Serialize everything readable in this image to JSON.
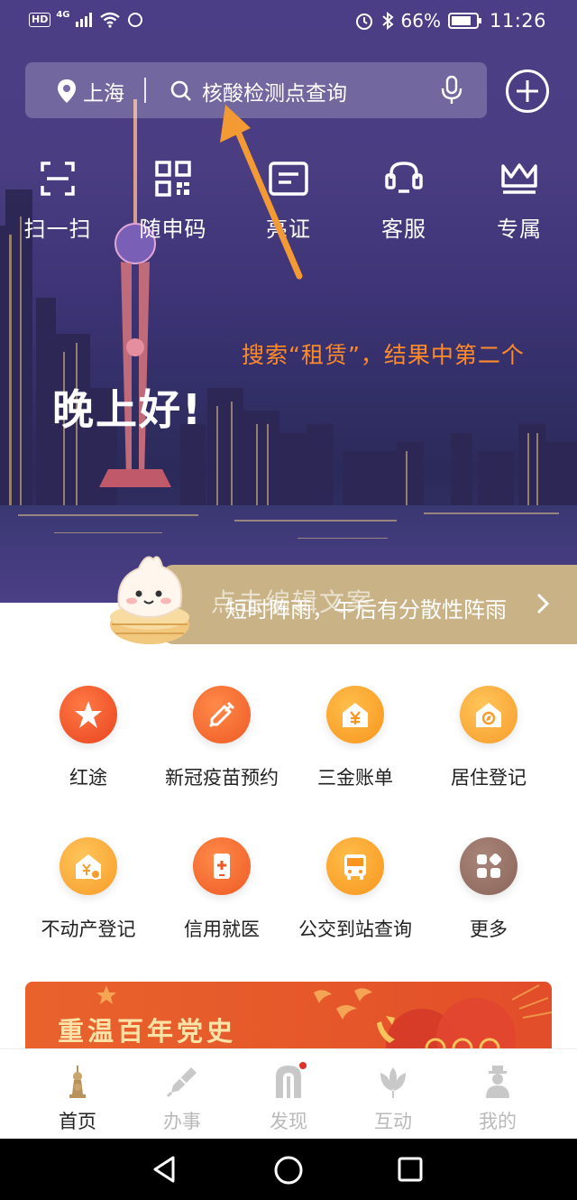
{
  "status_bar": {
    "hd": "HD",
    "network": "4G",
    "battery": "66%",
    "time": "11:26"
  },
  "search": {
    "city": "上海",
    "query": "核酸检测点查询"
  },
  "quick_actions": [
    {
      "label": "扫一扫",
      "icon": "scan-icon"
    },
    {
      "label": "随申码",
      "icon": "qr-code-icon"
    },
    {
      "label": "亮证",
      "icon": "id-card-icon"
    },
    {
      "label": "客服",
      "icon": "customer-service-icon"
    },
    {
      "label": "专属",
      "icon": "crown-icon"
    }
  ],
  "annotation": "搜索“租赁”，结果中第二个",
  "greeting": "晚上好!",
  "weather": {
    "placeholder": "点击编辑文案",
    "text": "短时阵雨，午后有分散性阵雨"
  },
  "services": [
    {
      "label": "红途",
      "icon": "star-icon",
      "color": "#f0512b"
    },
    {
      "label": "新冠疫苗预约",
      "icon": "syringe-icon",
      "color": "#f06a2d"
    },
    {
      "label": "三金账单",
      "icon": "house-yuan-icon",
      "color": "#f79b2c"
    },
    {
      "label": "居住登记",
      "icon": "house-compass-icon",
      "color": "#f7a531"
    },
    {
      "label": "不动产登记",
      "icon": "property-icon",
      "color": "#f7a531"
    },
    {
      "label": "信用就医",
      "icon": "medical-phone-icon",
      "color": "#f06a2d"
    },
    {
      "label": "公交到站查询",
      "icon": "bus-icon",
      "color": "#f79b2c"
    },
    {
      "label": "更多",
      "icon": "more-grid-icon",
      "color": "#9b7569"
    }
  ],
  "banner": {
    "title": "重温百年党史"
  },
  "tabs": [
    {
      "label": "首页",
      "active": true
    },
    {
      "label": "办事",
      "active": false
    },
    {
      "label": "发现",
      "active": false
    },
    {
      "label": "互动",
      "active": false
    },
    {
      "label": "我的",
      "active": false
    }
  ]
}
